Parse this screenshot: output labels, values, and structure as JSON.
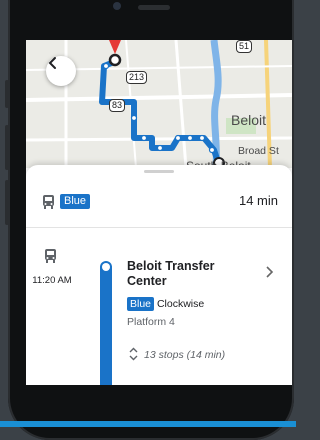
{
  "map": {
    "shields": [
      "51",
      "213",
      "83"
    ],
    "city_label": "Beloit",
    "road_label": "Broad St",
    "south_label": "South Beloit",
    "route_color": "#1a73c8",
    "pin_color": "#e53935"
  },
  "summary": {
    "route_badge": "Blue",
    "duration": "14 min"
  },
  "step": {
    "time": "11:20 AM",
    "stop_name": "Beloit Transfer Center",
    "route_badge": "Blue",
    "direction": "Clockwise",
    "platform": "Platform 4",
    "stops_summary": "13 stops (14 min)"
  },
  "icons": [
    "back-arrow-icon",
    "bus-icon",
    "chevron-right-icon",
    "expand-icon"
  ]
}
